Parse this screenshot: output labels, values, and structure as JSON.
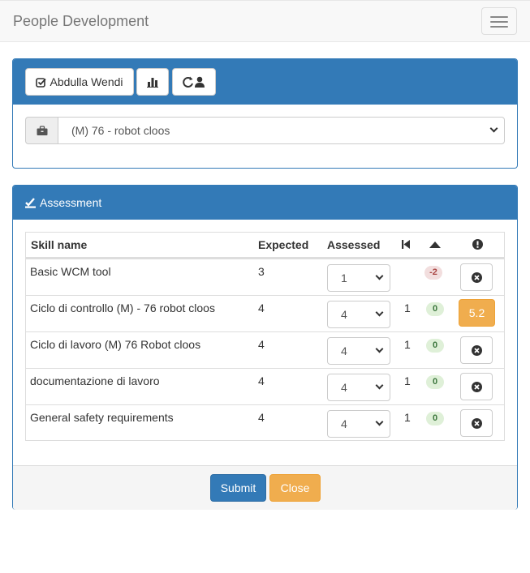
{
  "navbar": {
    "brand": "People Development",
    "menu_icon": "hamburger-icon"
  },
  "toolbar": {
    "user_label": "Abdulla Wendi",
    "user_icon": "check-square-icon",
    "chart_icon": "bar-chart-icon",
    "refresh_icon": "refresh-user-icon"
  },
  "workplace": {
    "icon": "briefcase-icon",
    "selected": "(M) 76 - robot cloos"
  },
  "assessment": {
    "title": "Assessment",
    "title_icon": "check-pen-icon",
    "headers": {
      "skill": "Skill name",
      "expected": "Expected",
      "assessed": "Assessed",
      "first_icon": "step-backward-icon",
      "up_icon": "triangle-up-icon",
      "info_icon": "exclamation-circle-icon"
    },
    "rows": [
      {
        "skill": "Basic WCM tool",
        "expected": "3",
        "assessed": "1",
        "previous": "",
        "delta": "-2",
        "action": ""
      },
      {
        "skill": "Ciclo di controllo (M) - 76 robot cloos",
        "expected": "4",
        "assessed": "4",
        "previous": "1",
        "delta": "0",
        "action": "5.2"
      },
      {
        "skill": "Ciclo di lavoro (M) 76 Robot cloos",
        "expected": "4",
        "assessed": "4",
        "previous": "1",
        "delta": "0",
        "action": ""
      },
      {
        "skill": "documentazione di lavoro",
        "expected": "4",
        "assessed": "4",
        "previous": "1",
        "delta": "0",
        "action": ""
      },
      {
        "skill": "General safety requirements",
        "expected": "4",
        "assessed": "4",
        "previous": "1",
        "delta": "0",
        "action": ""
      }
    ],
    "submit_label": "Submit",
    "close_label": "Close"
  },
  "colors": {
    "primary": "#337ab7",
    "warning": "#f0ad4e",
    "danger_bg": "#f2dede",
    "success_bg": "#dff0d8"
  }
}
